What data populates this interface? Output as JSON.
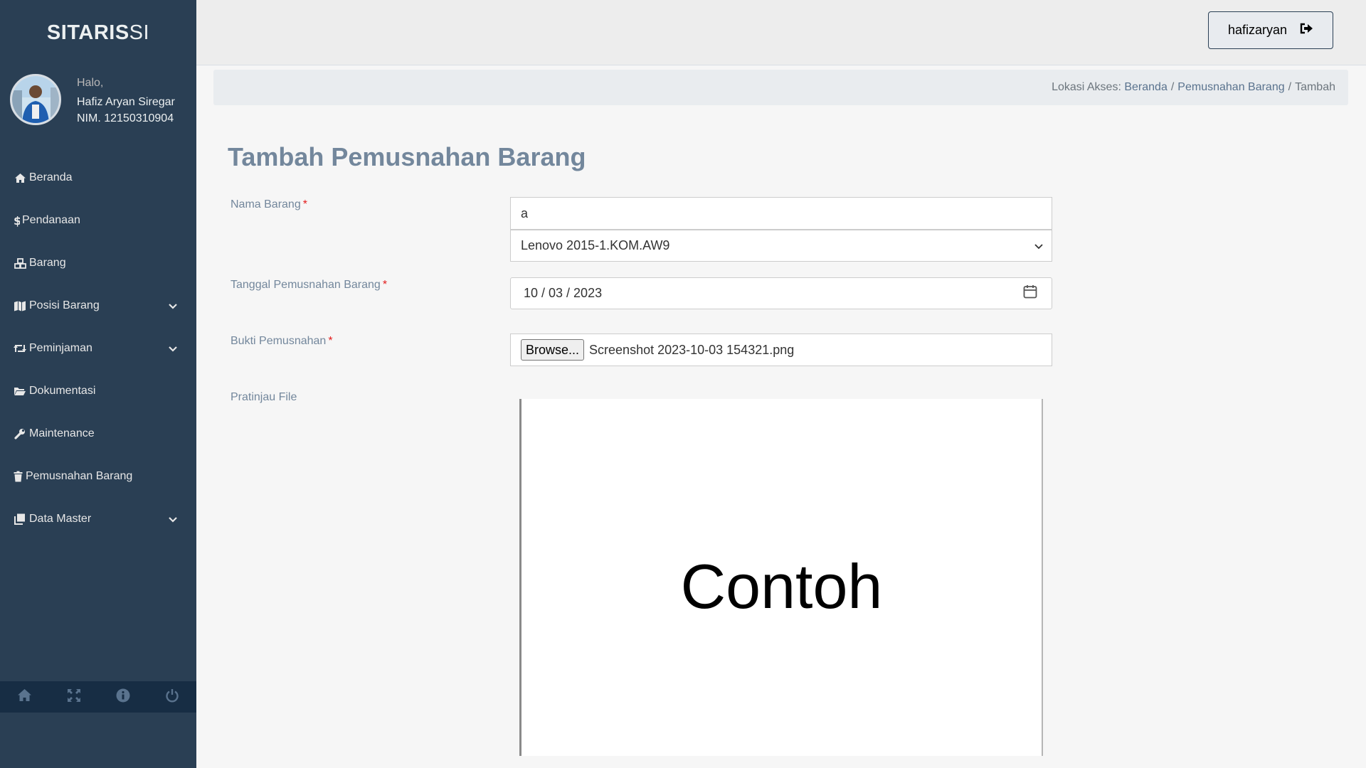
{
  "app": {
    "brand_bold": "SITARIS",
    "brand_rest": " SI"
  },
  "profile": {
    "greeting": "Halo,",
    "name": "Hafiz Aryan Siregar",
    "nim": "NIM. 12150310904"
  },
  "menu": [
    {
      "label": "Beranda",
      "icon": "home-icon"
    },
    {
      "label": "Pendanaan",
      "icon": "dollar-icon"
    },
    {
      "label": "Barang",
      "icon": "cubes-icon"
    },
    {
      "label": "Posisi Barang",
      "icon": "map-icon",
      "expandable": true
    },
    {
      "label": "Peminjaman",
      "icon": "retweet-icon",
      "expandable": true
    },
    {
      "label": "Dokumentasi",
      "icon": "folder-open-icon"
    },
    {
      "label": "Maintenance",
      "icon": "wrench-icon"
    },
    {
      "label": "Pemusnahan Barang",
      "icon": "trash-icon"
    },
    {
      "label": "Data Master",
      "icon": "clone-icon",
      "expandable": true
    }
  ],
  "footer_icons": [
    "home-icon",
    "fullscreen-icon",
    "info-icon",
    "power-icon"
  ],
  "topnav": {
    "username": "hafizaryan",
    "logout_icon": "sign-out-icon"
  },
  "breadcrumb": {
    "prefix": "Lokasi Akses:",
    "items": [
      "Beranda",
      "Pemusnahan Barang",
      "Tambah"
    ]
  },
  "form": {
    "title": "Tambah Pemusnahan Barang",
    "nama_barang": {
      "label": "Nama Barang",
      "required": "*",
      "search_value": "a",
      "selected": "Lenovo 2015-1.KOM.AW9"
    },
    "tanggal": {
      "label": "Tanggal Pemusnahan Barang",
      "required": "*",
      "value": "10 / 03 / 2023"
    },
    "bukti": {
      "label": "Bukti Pemusnahan",
      "required": "*",
      "browse_label": "Browse...",
      "file_name": "Screenshot 2023-10-03 154321.png"
    },
    "preview": {
      "label": "Pratinjau File",
      "image_text": "Contoh"
    }
  },
  "colors": {
    "sidebar": "#2a3f54",
    "footer": "#172d44",
    "title": "#73879c",
    "link": "#5a738e",
    "required": "#e31b1b"
  }
}
